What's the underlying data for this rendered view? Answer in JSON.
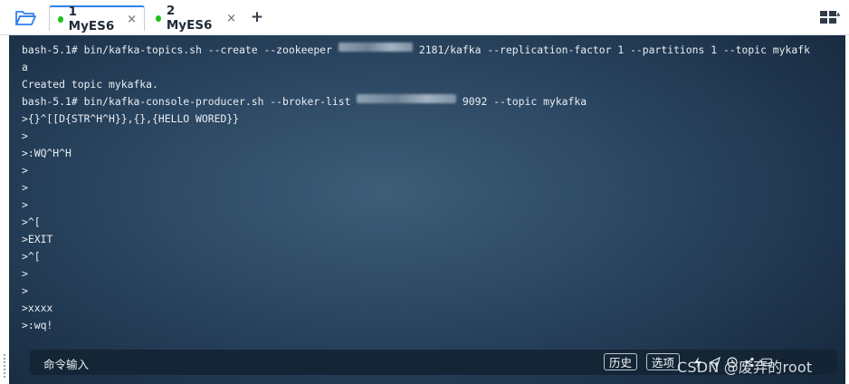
{
  "tabs": [
    {
      "label": "1 MyES6",
      "active": true,
      "status_color": "#1ec11e",
      "close": "×"
    },
    {
      "label": "2 MyES6",
      "active": false,
      "status_color": "#1ec11e",
      "close": "×"
    }
  ],
  "toolbar": {
    "add_tab_label": "+",
    "folder_icon": "folder-open-icon",
    "layout_icon": "grid-layout-icon"
  },
  "terminal": {
    "background": "#2a4560",
    "text_color": "#e9eef3",
    "lines": [
      {
        "segments": [
          {
            "text": "bash-5.1# bin/kafka-topics.sh --create --zookeeper "
          },
          {
            "text": "1_.___.__.__",
            "blurred": true
          },
          {
            "text": " 2181/kafka --replication-factor 1 --partitions 1 --topic mykafk"
          }
        ]
      },
      {
        "segments": [
          {
            "text": "a"
          }
        ]
      },
      {
        "segments": [
          {
            "text": "Created topic mykafka."
          }
        ]
      },
      {
        "segments": [
          {
            "text": "bash-5.1# bin/kafka-console-producer.sh --broker-list "
          },
          {
            "text": "__.___.___.__.__",
            "blurred": true
          },
          {
            "text": " 9092 --topic mykafka"
          }
        ]
      },
      {
        "segments": [
          {
            "text": ">{}^[[D{STR^H^H}},{},{HELLO WORED}}"
          }
        ]
      },
      {
        "segments": [
          {
            "text": ">"
          }
        ]
      },
      {
        "segments": [
          {
            "text": ">:WQ^H^H"
          }
        ]
      },
      {
        "segments": [
          {
            "text": ">"
          }
        ]
      },
      {
        "segments": [
          {
            "text": ">"
          }
        ]
      },
      {
        "segments": [
          {
            "text": ">"
          }
        ]
      },
      {
        "segments": [
          {
            "text": ">^["
          }
        ]
      },
      {
        "segments": [
          {
            "text": ">EXIT"
          }
        ]
      },
      {
        "segments": [
          {
            "text": ">^["
          }
        ]
      },
      {
        "segments": [
          {
            "text": ">"
          }
        ]
      },
      {
        "segments": [
          {
            "text": ">"
          }
        ]
      },
      {
        "segments": [
          {
            "text": ">xxxx"
          }
        ]
      },
      {
        "segments": [
          {
            "text": ">:wq!"
          }
        ]
      }
    ]
  },
  "command_bar": {
    "placeholder": "命令输入",
    "history_label": "历史",
    "options_label": "选项",
    "icons": [
      "lightning-icon",
      "send-icon",
      "clock-icon",
      "share-icon",
      "keyboard-icon"
    ]
  },
  "watermark": "CSDN @废弃的root"
}
